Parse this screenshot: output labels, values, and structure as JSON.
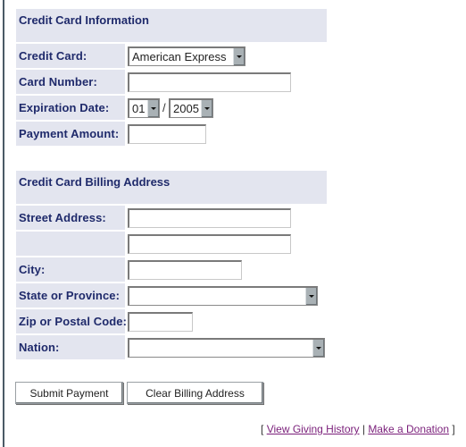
{
  "card_section": {
    "title": "Credit Card Information",
    "fields": {
      "credit_card": {
        "label": "Credit Card:",
        "selected": "American Express"
      },
      "card_number": {
        "label": "Card Number:",
        "value": ""
      },
      "expiration": {
        "label": "Expiration Date:",
        "month": "01",
        "separator": "/",
        "year": "2005"
      },
      "payment_amount": {
        "label": "Payment Amount:",
        "value": ""
      }
    }
  },
  "billing_section": {
    "title": "Credit Card Billing Address",
    "fields": {
      "street": {
        "label": "Street Address:",
        "value1": "",
        "value2": ""
      },
      "city": {
        "label": "City:",
        "value": ""
      },
      "state": {
        "label": "State or Province:",
        "selected": ""
      },
      "zip": {
        "label": "Zip or Postal Code:",
        "value": ""
      },
      "nation": {
        "label": "Nation:",
        "selected": ""
      }
    }
  },
  "buttons": {
    "submit": "Submit Payment",
    "clear": "Clear Billing Address"
  },
  "footer": {
    "open_bracket": "[",
    "separator": "|",
    "close_bracket": "]",
    "links": [
      "View Giving History",
      "Make a Donation"
    ]
  },
  "colors": {
    "label_text": "#1f2a6b",
    "cell_bg": "#e3e5ef",
    "link": "#7a1f7a"
  }
}
